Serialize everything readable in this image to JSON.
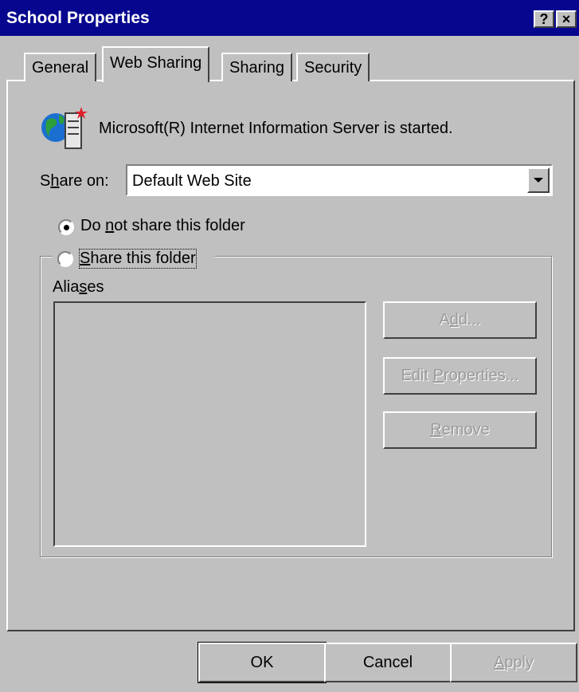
{
  "window": {
    "title": "School Properties",
    "help_button": "?",
    "close_button": "×"
  },
  "tabs": [
    {
      "label": "General"
    },
    {
      "label": "Web Sharing",
      "active": true
    },
    {
      "label": "Sharing"
    },
    {
      "label": "Security"
    }
  ],
  "server_status": "Microsoft(R) Internet Information Server is started.",
  "share_on": {
    "label_pre": "S",
    "label_accel": "h",
    "label_post": "are on:",
    "value": "Default Web Site"
  },
  "radio_do_not_share": {
    "pre": "Do ",
    "accel": "n",
    "post": "ot share this folder",
    "selected": true
  },
  "radio_share": {
    "pre": "",
    "accel": "S",
    "post": "hare this folder",
    "selected": false
  },
  "aliases": {
    "label_pre": "Alia",
    "label_accel": "s",
    "label_post": "es"
  },
  "buttons": {
    "add": {
      "pre": "A",
      "accel": "d",
      "post": "d...",
      "enabled": false
    },
    "edit_properties": {
      "pre": "Edit ",
      "accel": "P",
      "post": "roperties...",
      "enabled": false
    },
    "remove": {
      "pre": "",
      "accel": "R",
      "post": "emove",
      "enabled": false
    }
  },
  "footer": {
    "ok": "OK",
    "cancel": "Cancel",
    "apply": {
      "pre": "",
      "accel": "A",
      "post": "pply",
      "enabled": false
    }
  }
}
